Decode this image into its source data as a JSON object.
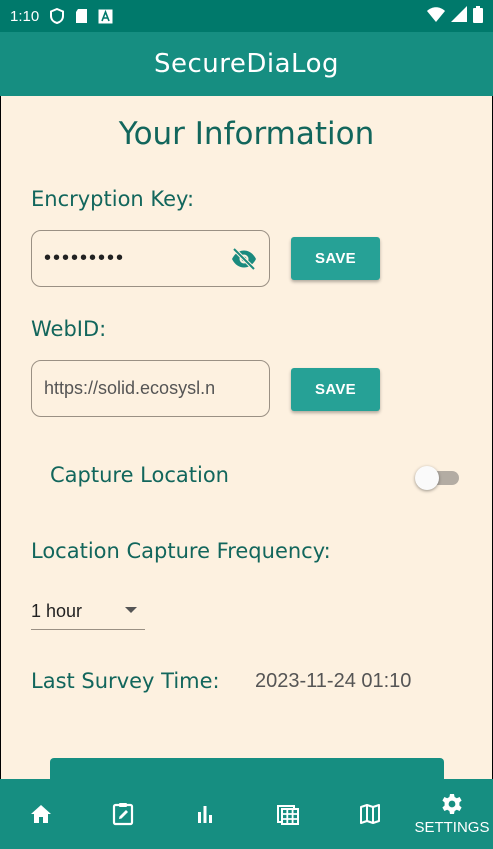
{
  "status_bar": {
    "time": "1:10",
    "left_icons": [
      "shield-icon",
      "sd-card-icon",
      "keyboard-a-icon"
    ],
    "right_icons": [
      "wifi-icon",
      "signal-icon",
      "battery-icon"
    ]
  },
  "app_bar": {
    "title": "SecureDiaLog"
  },
  "page": {
    "title": "Your Information"
  },
  "encryption": {
    "label": "Encryption Key:",
    "value": "•••••••••",
    "toggle_icon": "eye-off-icon",
    "save_label": "SAVE"
  },
  "webid": {
    "label": "WebID:",
    "value": "https://solid.ecosysl.n",
    "save_label": "SAVE"
  },
  "capture_location": {
    "label": "Capture Location",
    "enabled": false
  },
  "frequency": {
    "label": "Location Capture Frequency:",
    "selected": "1 hour"
  },
  "survey": {
    "label": "Last Survey Time:",
    "value": "2023-11-24 01:10"
  },
  "bottom_nav": {
    "items": [
      {
        "icon": "home-icon",
        "label": ""
      },
      {
        "icon": "edit-note-icon",
        "label": ""
      },
      {
        "icon": "bar-chart-icon",
        "label": ""
      },
      {
        "icon": "calendar-grid-icon",
        "label": ""
      },
      {
        "icon": "map-icon",
        "label": ""
      },
      {
        "icon": "gear-icon",
        "label": "SETTINGS"
      }
    ],
    "active_index": 5
  },
  "colors": {
    "primary": "#168e81",
    "status_bar": "#00796b",
    "background": "#fdf1e0",
    "text_primary": "#12665c",
    "button": "#26a196"
  }
}
